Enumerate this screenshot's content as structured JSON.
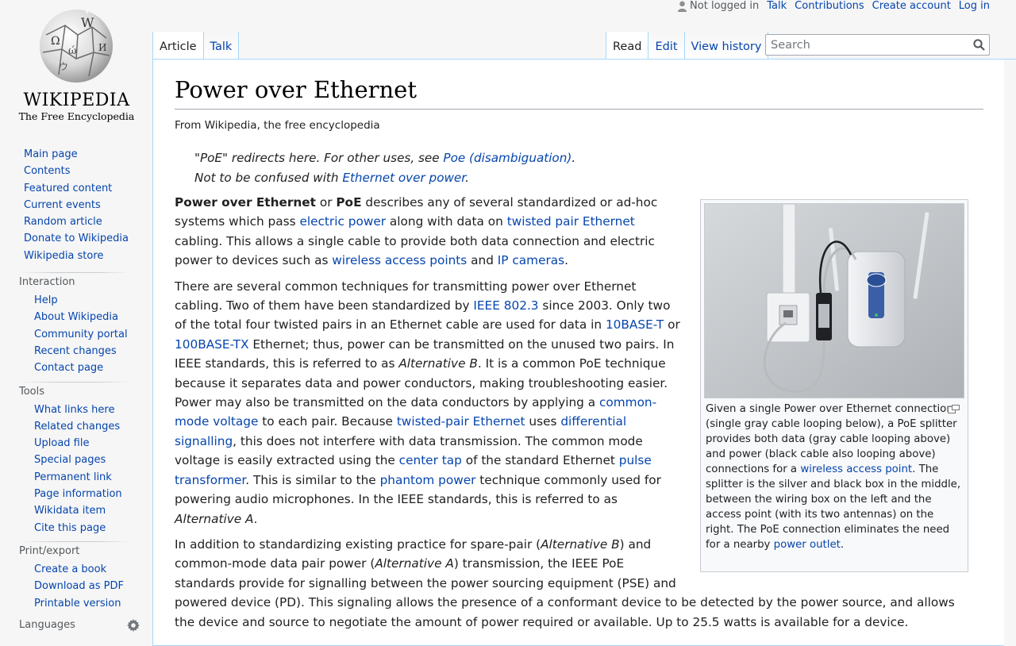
{
  "logo": {
    "wordmark": "WIKIPEDIA",
    "tagline": "The Free Encyclopedia"
  },
  "personal_tools": {
    "not_logged_in": "Not logged in",
    "talk": "Talk",
    "contributions": "Contributions",
    "create_account": "Create account",
    "log_in": "Log in"
  },
  "tabs": {
    "article": "Article",
    "talk": "Talk",
    "read": "Read",
    "edit": "Edit",
    "view_history": "View history"
  },
  "search": {
    "placeholder": "Search"
  },
  "sidebar": {
    "navigation": [
      "Main page",
      "Contents",
      "Featured content",
      "Current events",
      "Random article",
      "Donate to Wikipedia",
      "Wikipedia store"
    ],
    "interaction": {
      "heading": "Interaction",
      "items": [
        "Help",
        "About Wikipedia",
        "Community portal",
        "Recent changes",
        "Contact page"
      ]
    },
    "tools": {
      "heading": "Tools",
      "items": [
        "What links here",
        "Related changes",
        "Upload file",
        "Special pages",
        "Permanent link",
        "Page information",
        "Wikidata item",
        "Cite this page"
      ]
    },
    "print_export": {
      "heading": "Print/export",
      "items": [
        "Create a book",
        "Download as PDF",
        "Printable version"
      ]
    },
    "languages": {
      "heading": "Languages"
    }
  },
  "article": {
    "title": "Power over Ethernet",
    "site_sub": "From Wikipedia, the free encyclopedia",
    "hatnote1": {
      "pre": "\"PoE\" redirects here. For other uses, see ",
      "link": "Poe (disambiguation)",
      "post": "."
    },
    "hatnote2": {
      "pre": "Not to be confused with ",
      "link": "Ethernet over power",
      "post": "."
    },
    "thumb": {
      "caption": {
        "t1": "Given a single Power over Ethernet connection (single gray cable looping below), a PoE splitter provides both data (gray cable looping above) and power (black cable also looping above) connections for a ",
        "l1": "wireless access point",
        "t2": ". The splitter is the silver and black box in the middle, between the wiring box on the left and the access point (with its two antennas) on the right. The PoE connection eliminates the need for a nearby ",
        "l2": "power outlet",
        "t3": "."
      }
    },
    "p1": {
      "b1": "Power over Ethernet",
      "t1": " or ",
      "b2": "PoE",
      "t2": " describes any of several standardized or ad-hoc systems which pass ",
      "l1": "electric power",
      "t3": " along with data on ",
      "l2": "twisted pair Ethernet",
      "t4": " cabling. This allows a single cable to provide both data connection and electric power to devices such as ",
      "l3": "wireless access points",
      "t5": " and ",
      "l4": "IP cameras",
      "t6": "."
    },
    "p2": {
      "t1": "There are several common techniques for transmitting power over Ethernet cabling. Two of them have been standardized by ",
      "l1": "IEEE 802.3",
      "t2": " since 2003. Only two of the total four twisted pairs in an Ethernet cable are used for data in ",
      "l2": "10BASE-T",
      "t3": " or ",
      "l3": "100BASE-TX",
      "t4": " Ethernet; thus, power can be transmitted on the unused two pairs. In IEEE standards, this is referred to as ",
      "i1": "Alternative B",
      "t5": ". It is a common PoE technique because it separates data and power conductors, making troubleshooting easier. Power may also be transmitted on the data conductors by applying a ",
      "l4": "common-mode voltage",
      "t6": " to each pair. Because ",
      "l5": "twisted-pair Ethernet",
      "t7": " uses ",
      "l6": "differential signalling",
      "t8": ", this does not interfere with data transmission. The common mode voltage is easily extracted using the ",
      "l7": "center tap",
      "t9": " of the standard Ethernet ",
      "l8": "pulse transformer",
      "t10": ". This is similar to the ",
      "l9": "phantom power",
      "t11": " technique commonly used for powering audio microphones. In the IEEE standards, this is referred to as ",
      "i2": "Alternative A",
      "t12": "."
    },
    "p3": {
      "t1": "In addition to standardizing existing practice for spare-pair (",
      "i1": "Alternative B",
      "t2": ") and common-mode data pair power (",
      "i2": "Alternative A",
      "t3": ") transmission, the IEEE PoE standards provide for signalling between the power sourcing equipment (PSE) and powered device (PD). This signaling allows the presence of a conformant device to be detected by the power source, and allows the device and source to negotiate the amount of power required or available. Up to 25.5 watts is available for a device."
    }
  },
  "colors": {
    "link": "#0645ad",
    "tab_border": "#a7d7f9",
    "sidebar_bg": "#f6f6f6"
  }
}
